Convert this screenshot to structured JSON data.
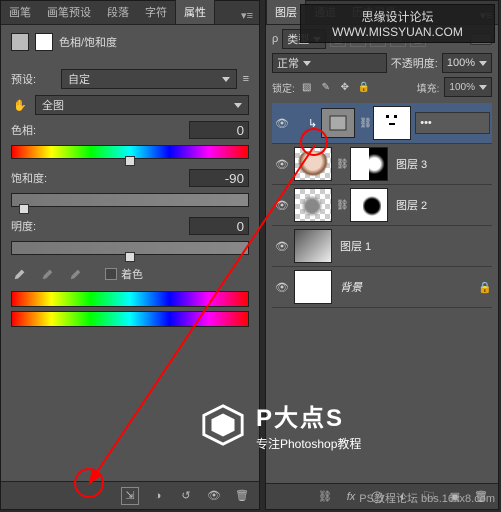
{
  "watermark": {
    "top": "思缘设计论坛  WWW.MISSYUAN.COM",
    "bottom": "bbs.16xx8.com",
    "footer_label": "PS教程论坛"
  },
  "logo": {
    "title": "P大点S",
    "subtitle": "专注Photoshop教程"
  },
  "props": {
    "tabs": [
      "画笔",
      "画笔预设",
      "段落",
      "字符",
      "属性"
    ],
    "active_tab": 4,
    "title": "色相/饱和度",
    "preset_label": "预设:",
    "preset_value": "自定",
    "channel_value": "全图",
    "hue_label": "色相:",
    "hue_value": "0",
    "sat_label": "饱和度:",
    "sat_value": "-90",
    "light_label": "明度:",
    "light_value": "0",
    "colorize_label": "着色",
    "bottom_icons": [
      "clip-icon",
      "prev-state-icon",
      "reset-icon",
      "toggle-visibility-icon",
      "delete-icon"
    ]
  },
  "layers": {
    "tabs": [
      "图层",
      "通道",
      "历史记录"
    ],
    "active_tab": 0,
    "filter_label": "类型",
    "blend_mode": "正常",
    "opacity_label": "不透明度:",
    "opacity_value": "100%",
    "lock_label": "锁定:",
    "fill_label": "填充:",
    "fill_value": "100%",
    "items": [
      {
        "type": "adjustment",
        "name": "",
        "selected": true,
        "hasMask": true
      },
      {
        "type": "bitmap",
        "name": "图层 3",
        "hasMask": true,
        "thumb": "portrait"
      },
      {
        "type": "bitmap",
        "name": "图层 2",
        "hasMask": true,
        "thumb": "blob"
      },
      {
        "type": "bitmap",
        "name": "图层 1",
        "hasMask": false,
        "thumb": "gradient"
      },
      {
        "type": "bitmap",
        "name": "背景",
        "hasMask": false,
        "thumb": "white",
        "locked": true
      }
    ],
    "bottom_icons": [
      "link-layers",
      "fx",
      "add-mask",
      "new-adjustment",
      "new-group",
      "new-layer",
      "delete-layer"
    ]
  }
}
